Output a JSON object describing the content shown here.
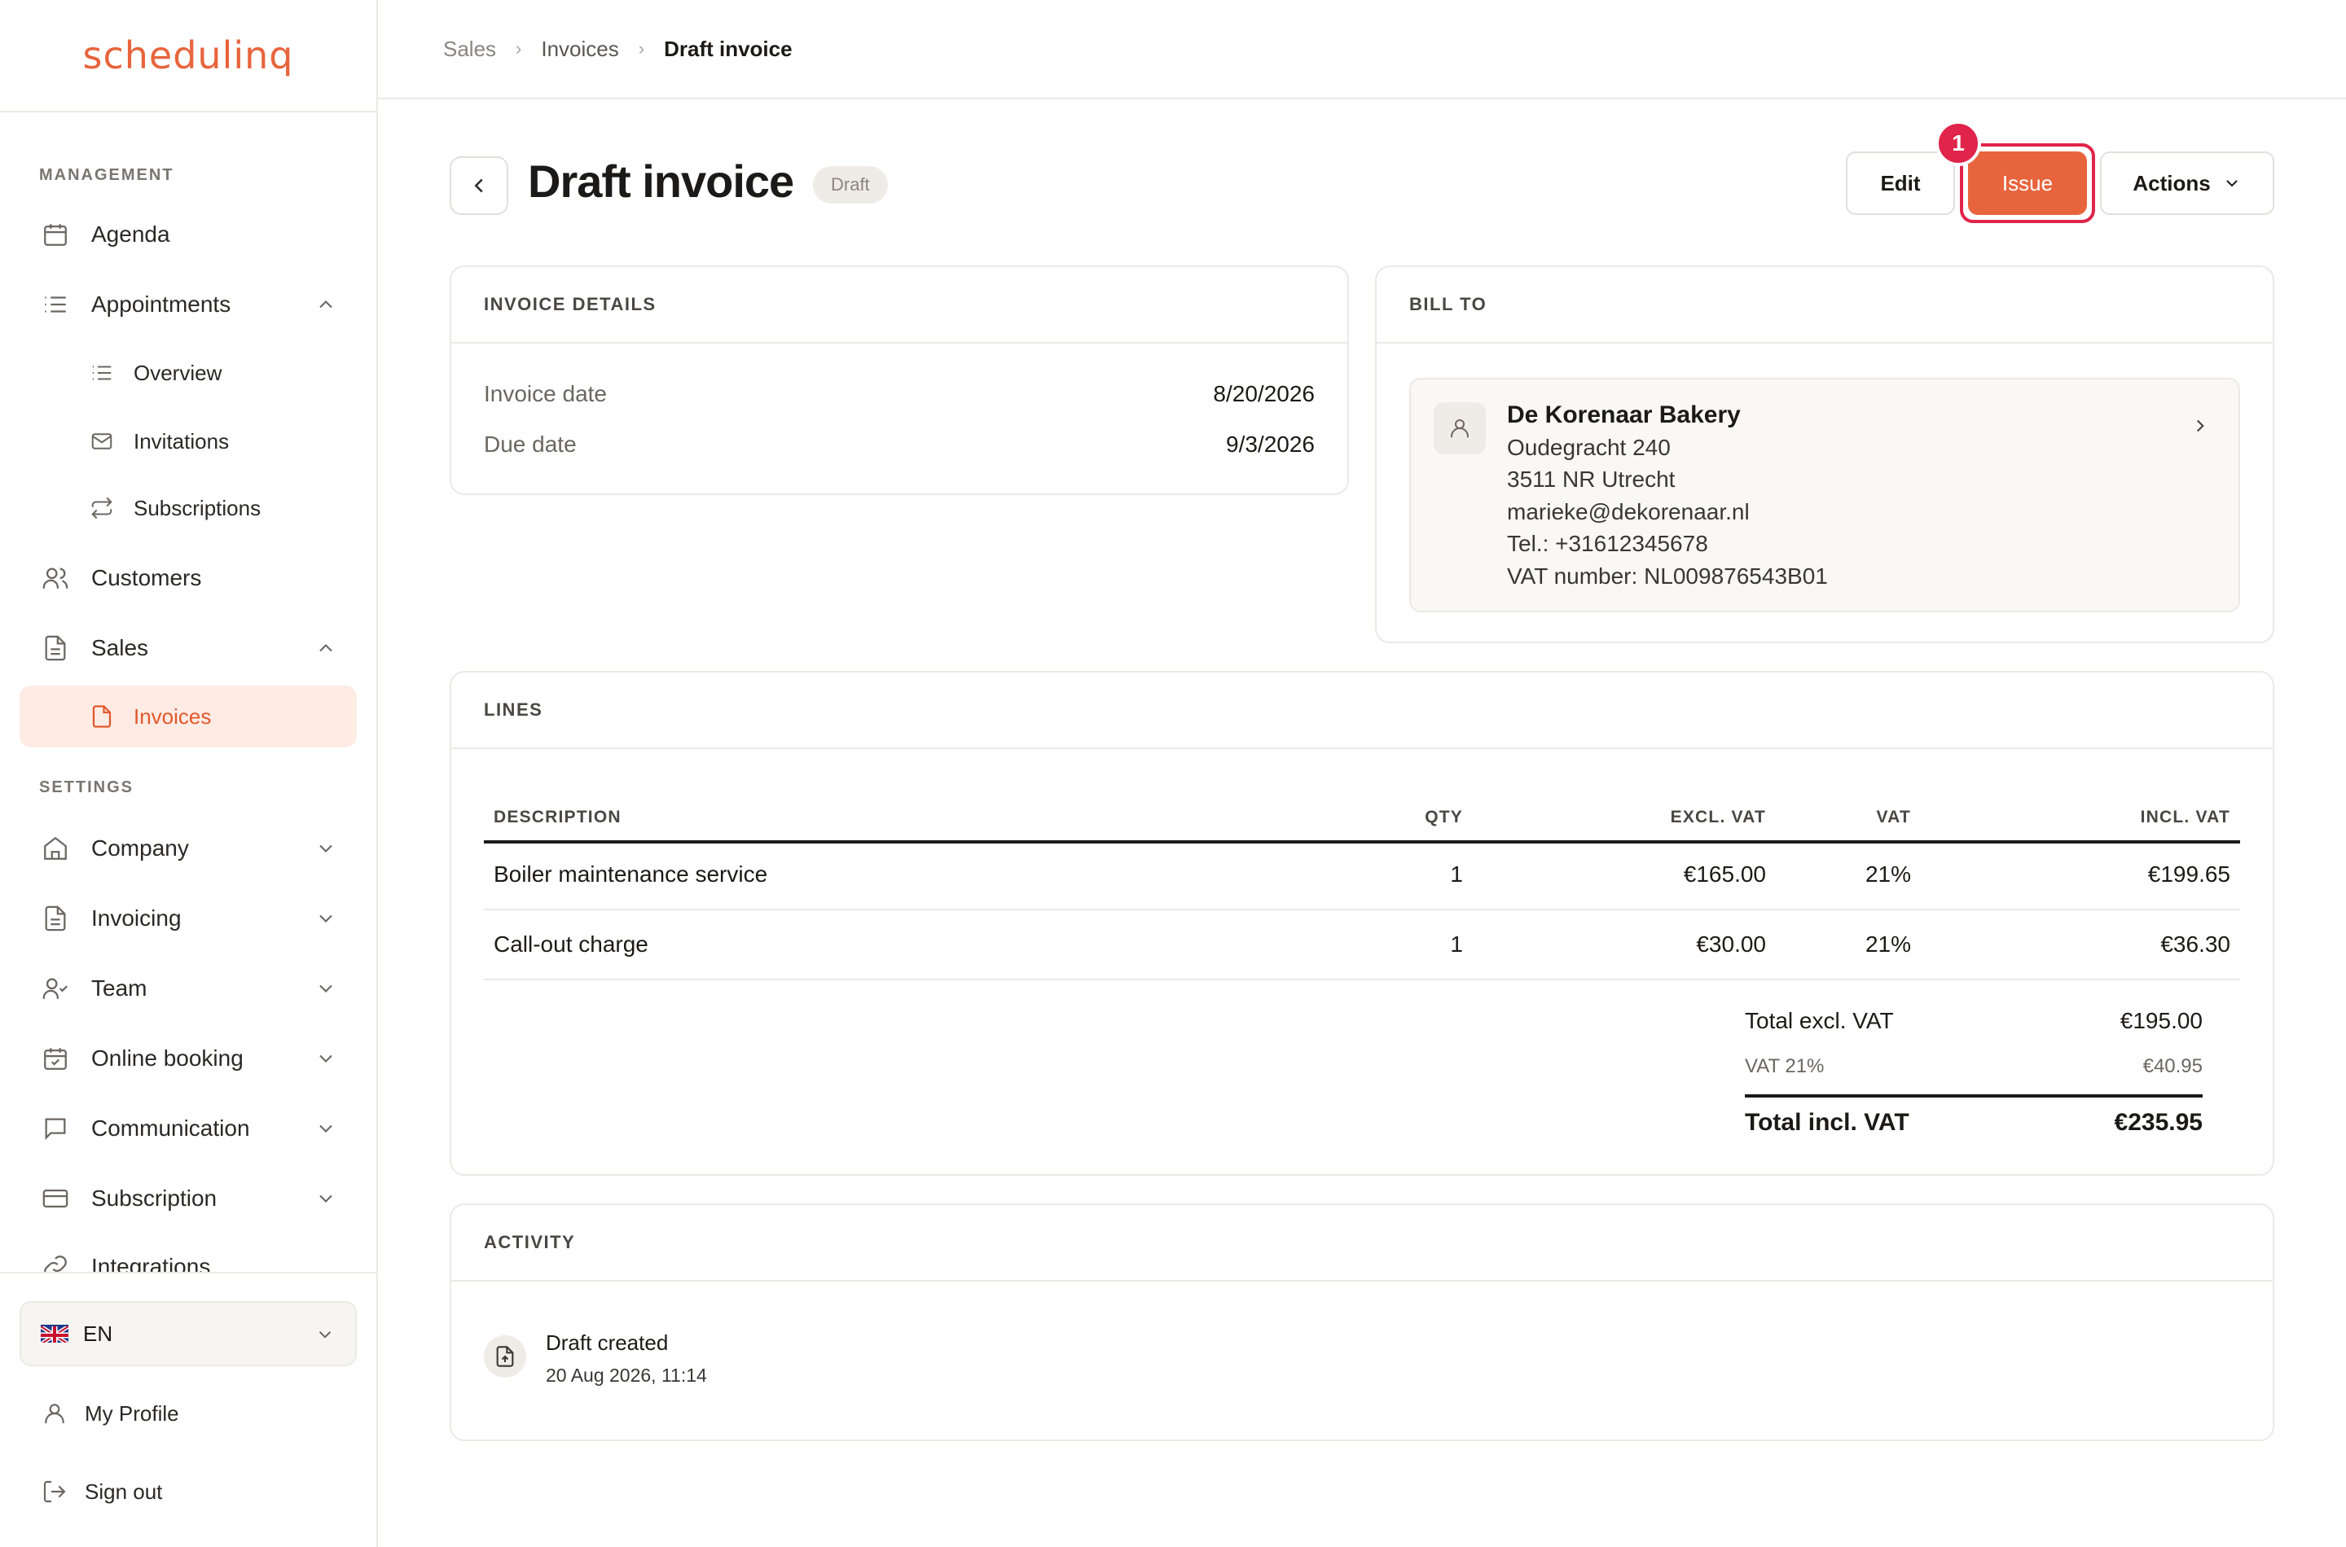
{
  "app": {
    "logo": "schedulinq"
  },
  "sidebar": {
    "section_management": "MANAGEMENT",
    "section_settings": "SETTINGS",
    "items": {
      "agenda": "Agenda",
      "appointments": "Appointments",
      "overview": "Overview",
      "invitations": "Invitations",
      "subscriptions": "Subscriptions",
      "customers": "Customers",
      "sales": "Sales",
      "invoices": "Invoices",
      "company": "Company",
      "invoicing": "Invoicing",
      "team": "Team",
      "online_booking": "Online booking",
      "communication": "Communication",
      "subscription": "Subscription",
      "integrations": "Integrations"
    },
    "language": "EN",
    "my_profile": "My Profile",
    "sign_out": "Sign out"
  },
  "breadcrumb": [
    "Sales",
    "Invoices",
    "Draft invoice"
  ],
  "header": {
    "title": "Draft invoice",
    "status_badge": "Draft",
    "edit_label": "Edit",
    "issue_label": "Issue",
    "actions_label": "Actions",
    "step_marker": "1"
  },
  "invoice_details": {
    "heading": "INVOICE DETAILS",
    "invoice_date_label": "Invoice date",
    "invoice_date": "8/20/2026",
    "due_date_label": "Due date",
    "due_date": "9/3/2026"
  },
  "bill_to": {
    "heading": "BILL TO",
    "name": "De Korenaar Bakery",
    "street": "Oudegracht 240",
    "city": "3511 NR Utrecht",
    "email": "marieke@dekorenaar.nl",
    "phone": "Tel.: +31612345678",
    "vat": "VAT number: NL009876543B01"
  },
  "lines": {
    "heading": "LINES",
    "columns": {
      "description": "DESCRIPTION",
      "qty": "QTY",
      "excl": "EXCL. VAT",
      "vat": "VAT",
      "incl": "INCL. VAT"
    },
    "rows": [
      {
        "description": "Boiler maintenance service",
        "qty": "1",
        "excl": "€165.00",
        "vat": "21%",
        "incl": "€199.65"
      },
      {
        "description": "Call-out charge",
        "qty": "1",
        "excl": "€30.00",
        "vat": "21%",
        "incl": "€36.30"
      }
    ],
    "totals": {
      "excl_label": "Total excl. VAT",
      "excl_value": "€195.00",
      "vat_label": "VAT 21%",
      "vat_value": "€40.95",
      "incl_label": "Total incl. VAT",
      "incl_value": "€235.95"
    }
  },
  "activity": {
    "heading": "ACTIVITY",
    "entries": [
      {
        "title": "Draft created",
        "time": "20 Aug 2026, 11:14"
      }
    ]
  },
  "colors": {
    "brand": "#e8643c",
    "highlight": "#e0244a",
    "active_bg": "#fdebe4"
  }
}
